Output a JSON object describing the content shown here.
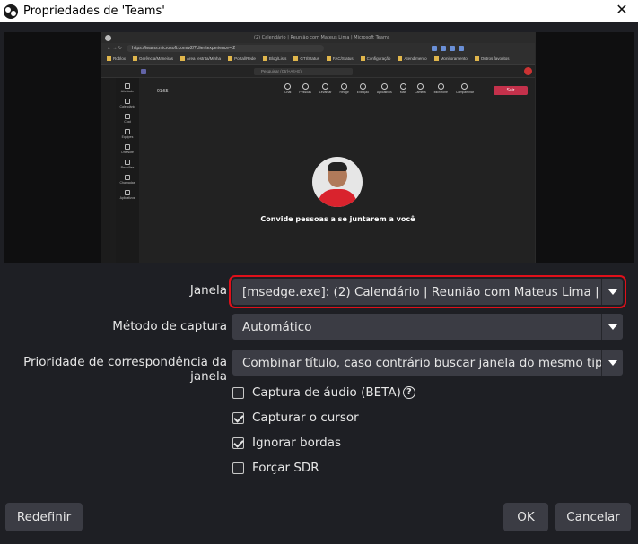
{
  "window": {
    "title": "Propriedades de 'Teams'",
    "app_icon": "obs-icon",
    "close_glyph": "✕"
  },
  "preview": {
    "tab_title": "(2) Calendário | Reunião com Mateus Lima | Microsoft Teams",
    "url": "https://teams.microsoft.com/v2/?clientexperience=t2",
    "favorites": [
      "Roblox",
      "Gerência/Maneiras",
      "Área restrita/Minha",
      "Portal/Rede",
      "Blog/Lists",
      "GTI/Status",
      "FAC/Status",
      "Configuração",
      "Atendimento",
      "Monitoramento",
      "Outros favoritos"
    ],
    "search_placeholder": "Pesquisar (Ctrl+Alt+E)",
    "timer": "01:55",
    "controls": [
      "Chat",
      "Pessoas",
      "Levantar",
      "Reagir",
      "Exibição",
      "Aplicativos",
      "Mais",
      "Câmera",
      "Microfone",
      "Compartilhar"
    ],
    "leave_label": "Sair",
    "rail_items": [
      "Atividade",
      "Calendário",
      "Chat",
      "Equipes",
      "OneNote",
      "Reuniões",
      "Chamadas",
      "Aplicativos"
    ],
    "invite_text": "Convide pessoas a se juntarem a você"
  },
  "form": {
    "window_label": "Janela",
    "window_value": "[msedge.exe]: (2) Calendário | Reunião com Mateus Lima | Microsoft Teams",
    "capture_method_label": "Método de captura",
    "capture_method_value": "Automático",
    "priority_label": "Prioridade de correspondência da janela",
    "priority_value": "Combinar título, caso contrário buscar janela do mesmo tipo",
    "checkboxes": [
      {
        "label": "Captura de áudio (BETA)",
        "checked": false
      },
      {
        "label": "Capturar o cursor",
        "checked": true
      },
      {
        "label": "Ignorar bordas",
        "checked": true
      },
      {
        "label": "Forçar SDR",
        "checked": false
      }
    ],
    "help_glyph": "?"
  },
  "buttons": {
    "reset": "Redefinir",
    "ok": "OK",
    "cancel": "Cancelar"
  },
  "colors": {
    "background": "#1e1f24",
    "control": "#3b3c44",
    "highlight_outline": "#e0101a",
    "leave_button": "#c4314b"
  }
}
